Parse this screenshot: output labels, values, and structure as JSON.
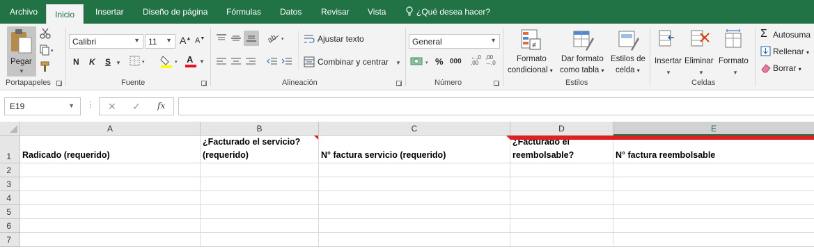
{
  "tabs": [
    "Archivo",
    "Inicio",
    "Insertar",
    "Diseño de página",
    "Fórmulas",
    "Datos",
    "Revisar",
    "Vista"
  ],
  "tell_me": "¿Qué desea hacer?",
  "ribbon": {
    "clipboard": {
      "paste": "Pegar",
      "label": "Portapapeles"
    },
    "font": {
      "family": "Calibri",
      "size": "11",
      "grow": "A",
      "shrink": "A",
      "bold": "N",
      "italic": "K",
      "underline": "S",
      "color_letter": "A",
      "label": "Fuente"
    },
    "alignment": {
      "wrap": "Ajustar texto",
      "merge": "Combinar y centrar",
      "label": "Alineación"
    },
    "number": {
      "format": "General",
      "percent": "%",
      "thousands": "000",
      "inc_dec": "←,0 ,00",
      "dec_dec": ",00 →,0",
      "label": "Número"
    },
    "styles": {
      "conditional": [
        "Formato",
        "condicional"
      ],
      "as_table": [
        "Dar formato",
        "como tabla"
      ],
      "cell_styles": [
        "Estilos de",
        "celda"
      ],
      "label": "Estilos"
    },
    "cells": {
      "insert": "Insertar",
      "delete": "Eliminar",
      "format": "Formato",
      "label": "Celdas"
    },
    "editing": {
      "autosum": "Autosuma",
      "fill": "Rellenar",
      "clear": "Borrar"
    }
  },
  "formula_bar": {
    "name_box": "E19",
    "fx": "fx",
    "cancel": "✕",
    "enter": "✓",
    "formula": ""
  },
  "sheet": {
    "columns": [
      "A",
      "B",
      "C",
      "D",
      "E"
    ],
    "rows": [
      "1",
      "2",
      "3",
      "4",
      "5",
      "6",
      "7"
    ],
    "header_cells": [
      "Radicado (requerido)",
      "¿Facturado el servicio? (requerido)",
      "N° factura servicio (requerido)",
      "¿Facturado el reembolsable?",
      "N° factura reembolsable"
    ]
  },
  "colors": {
    "brand": "#217346",
    "note_marker": "#e02020",
    "font_color_bar": "#e81123",
    "highlight_bar": "#ffff00"
  }
}
